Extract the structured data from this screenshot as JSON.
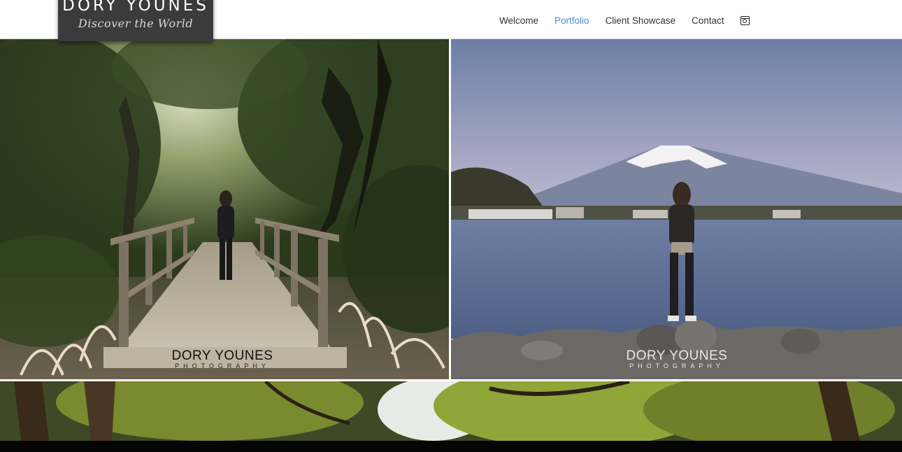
{
  "brand": {
    "name": "DORY YOUNES",
    "tagline": "Discover the World"
  },
  "nav": {
    "items": [
      {
        "label": "Welcome"
      },
      {
        "label": "Portfolio",
        "active": true
      },
      {
        "label": "Client Showcase"
      },
      {
        "label": "Contact"
      }
    ],
    "icon": "instagram-icon"
  },
  "gallery": {
    "photos": [
      {
        "scene": "forest-bridge",
        "watermark_name": "DORY YOUNES",
        "watermark_sub": "PHOTOGRAPHY"
      },
      {
        "scene": "mount-fuji-lake",
        "watermark_name": "DORY YOUNES",
        "watermark_sub": "PHOTOGRAPHY"
      },
      {
        "scene": "tree-canopy"
      }
    ]
  },
  "colors": {
    "nav_active": "#4a8bd8",
    "logo_bg": "#3b3b3b"
  }
}
